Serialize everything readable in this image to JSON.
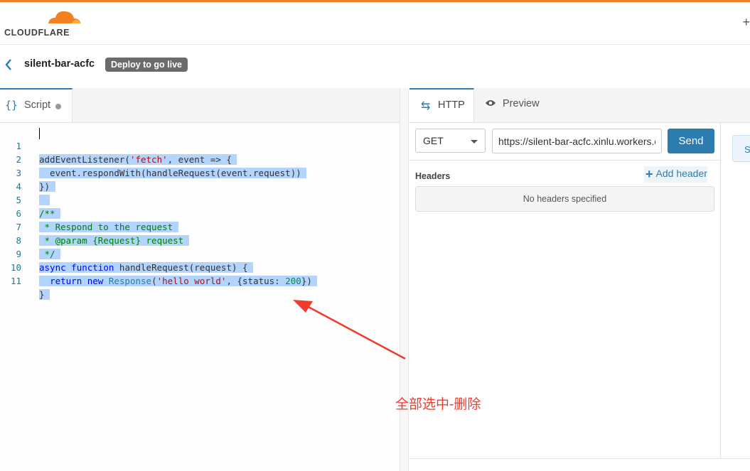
{
  "brand": {
    "logo_text": "CLOUDFLARE",
    "accent_color": "#f38020",
    "logo_icon": "cloudflare-cloud-icon"
  },
  "header": {
    "right_icon_text": "+"
  },
  "titlebar": {
    "back_icon": "chevron-left-icon",
    "worker_name": "silent-bar-acfc",
    "badge": "Deploy to go live"
  },
  "editor": {
    "tab_icon_text": "{}",
    "tab_label": "Script",
    "line_numbers": [
      "1",
      "2",
      "3",
      "4",
      "5",
      "6",
      "7",
      "8",
      "9",
      "10",
      "11"
    ]
  },
  "request": {
    "tabs": {
      "http_icon": "arrows-icon",
      "http_label": "HTTP",
      "preview_icon": "eye-icon",
      "preview_label": "Preview"
    },
    "method": "GET",
    "url": "https://silent-bar-acfc.xinlu.workers.dev",
    "send_label": "Send",
    "headers_label": "Headers",
    "add_header_label": "Add header",
    "no_headers_text": "No headers specified",
    "side_button_text": "S"
  },
  "annotation": {
    "text": "全部选中-删除",
    "color": "#f03c2e"
  }
}
